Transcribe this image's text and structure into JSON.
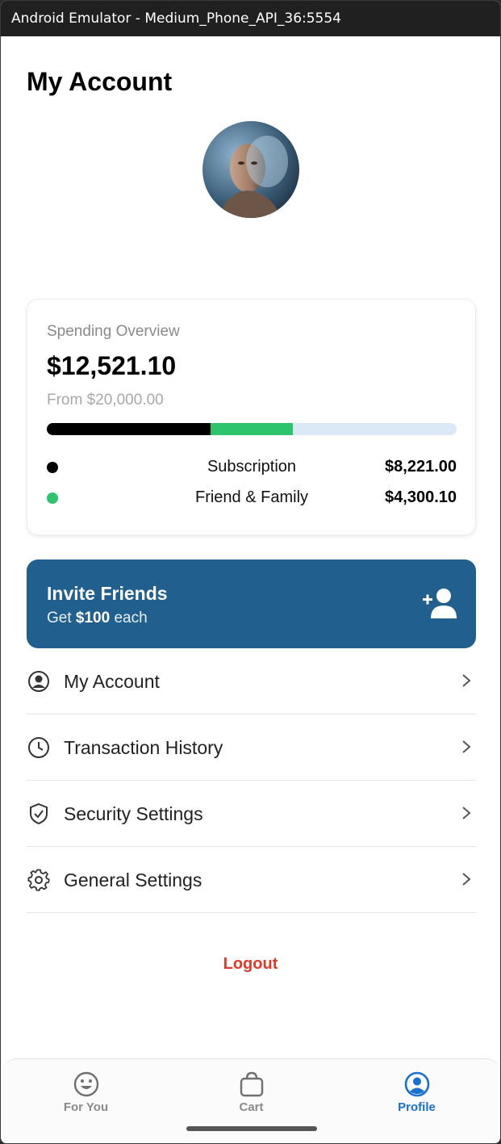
{
  "window": {
    "title": "Android Emulator - Medium_Phone_API_36:5554"
  },
  "page": {
    "title": "My Account"
  },
  "spending": {
    "label": "Spending Overview",
    "total": "$12,521.10",
    "from": "From $20,000.00",
    "progress": {
      "subscription_fraction": 0.4,
      "friends_fraction": 0.2,
      "track_color": "#dbe9f6"
    },
    "rows": [
      {
        "name": "Subscription",
        "value": "$8,221.00",
        "color": "#000000"
      },
      {
        "name": "Friend & Family",
        "value": "$4,300.10",
        "color": "#2ec46e"
      }
    ]
  },
  "invite": {
    "title": "Invite Friends",
    "sub_prefix": "Get ",
    "sub_amount": "$100",
    "sub_suffix": " each",
    "icon": "add-user-icon",
    "color": "#21608e"
  },
  "menu": [
    {
      "label": "My Account",
      "icon": "user-circle-icon"
    },
    {
      "label": "Transaction History",
      "icon": "clock-icon"
    },
    {
      "label": "Security Settings",
      "icon": "shield-check-icon"
    },
    {
      "label": "General Settings",
      "icon": "gear-icon"
    }
  ],
  "logout": {
    "label": "Logout",
    "color": "#e0392a"
  },
  "bottom_nav": [
    {
      "label": "For You",
      "icon": "smiley-icon",
      "active": false
    },
    {
      "label": "Cart",
      "icon": "bag-icon",
      "active": false
    },
    {
      "label": "Profile",
      "icon": "profile-icon",
      "active": true
    }
  ],
  "colors": {
    "accent": "#1a6fd1",
    "inactive": "#8a8a8a"
  }
}
